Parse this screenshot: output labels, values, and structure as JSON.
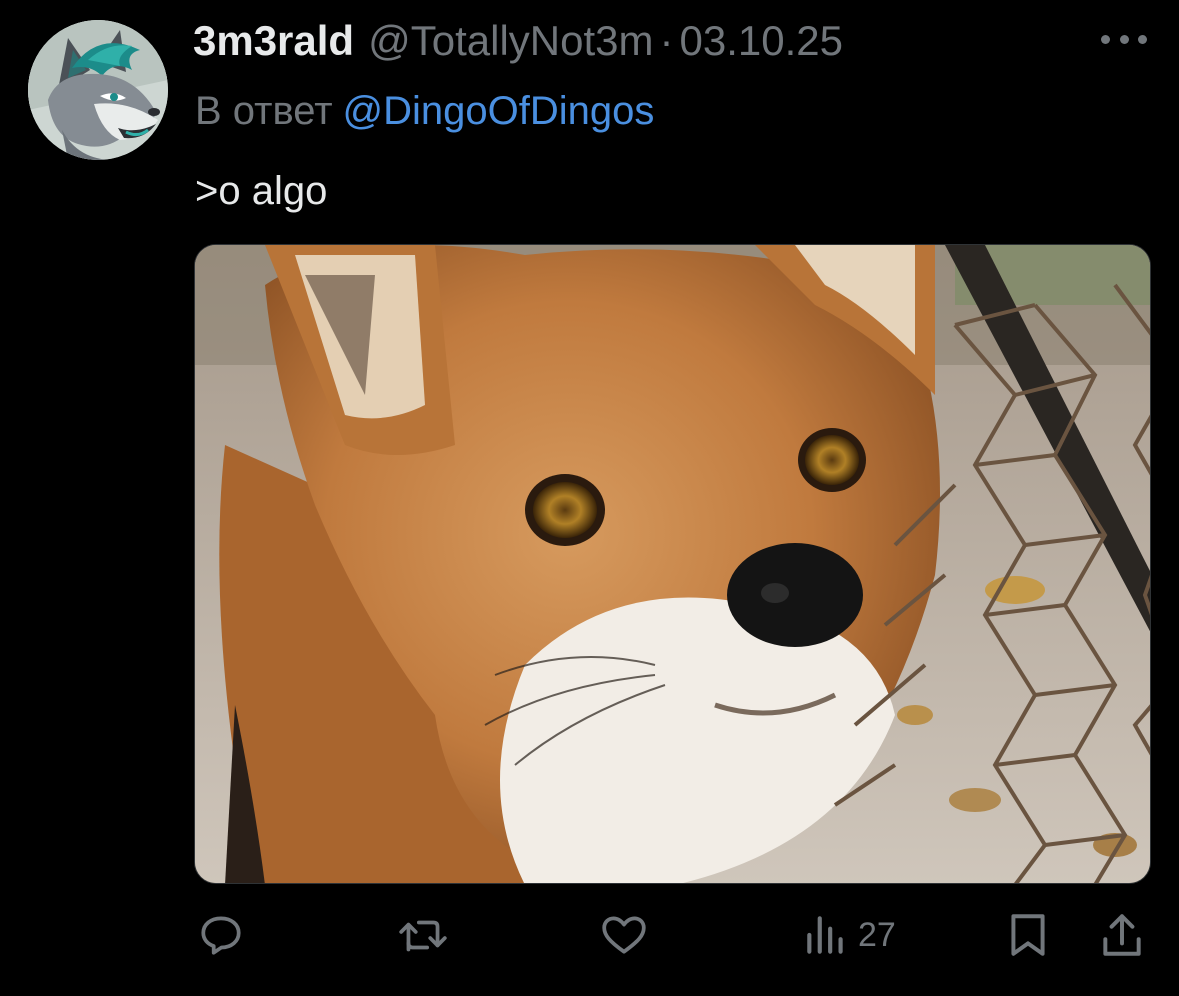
{
  "tweet": {
    "display_name": "3m3rald",
    "handle": "@TotallyNot3m",
    "separator": "·",
    "date": "03.10.25",
    "reply_prefix": "В ответ",
    "reply_to": "@DingoOfDingos",
    "text": ">o algo"
  },
  "icons": {
    "avatar": "wolf-avatar",
    "more": "more-dots-icon",
    "reply": "reply-icon",
    "retweet": "retweet-icon",
    "like": "heart-icon",
    "views": "views-bar-chart-icon",
    "bookmark": "bookmark-icon",
    "share": "share-icon"
  },
  "actions": {
    "views_count": "27"
  },
  "colors": {
    "background": "#000000",
    "text_primary": "#e7e9ea",
    "text_secondary": "#71767b",
    "link": "#4a8fe0"
  }
}
